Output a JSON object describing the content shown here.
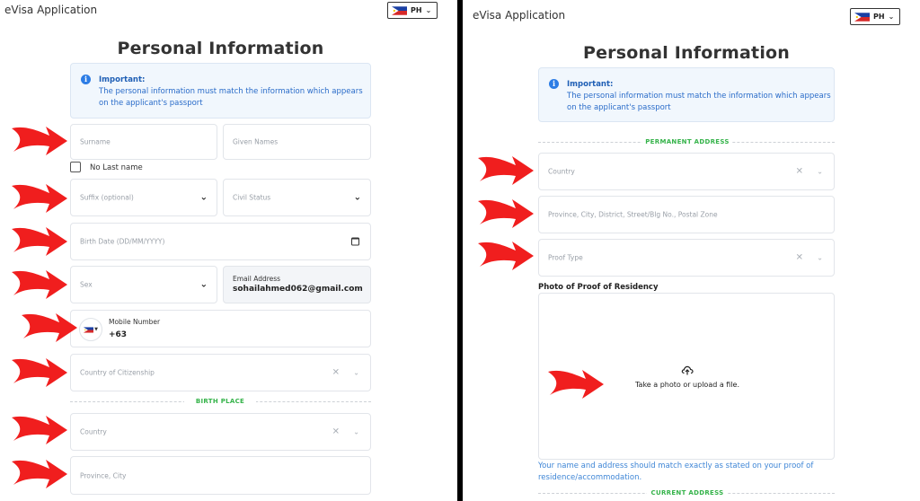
{
  "colors": {
    "accent_blue": "#2d7de5",
    "section_green": "#35b34a",
    "arrow_red": "#f01e1e"
  },
  "left": {
    "app_title": "eVisa Application",
    "language": "PH",
    "page_title": "Personal Information",
    "notice_title": "Important:",
    "notice_line1": "The personal information must match the information which appears",
    "notice_line2": "on the applicant's passport",
    "surname_placeholder": "Surname",
    "given_names_placeholder": "Given Names",
    "no_last_name_label": "No Last name",
    "suffix_placeholder": "Suffix (optional)",
    "civil_status_placeholder": "Civil Status",
    "birth_date_placeholder": "Birth Date (DD/MM/YYYY)",
    "sex_placeholder": "Sex",
    "email_label": "Email Address",
    "email_value": "sohailahmed062@gmail.com",
    "mobile_label": "Mobile Number",
    "mobile_value": "+63",
    "citizenship_placeholder": "Country of Citizenship",
    "birth_place_section": "BIRTH PLACE",
    "country_placeholder": "Country",
    "province_city_placeholder": "Province, City"
  },
  "right": {
    "app_title": "eVisa Application",
    "language": "PH",
    "page_title": "Personal Information",
    "notice_title": "Important:",
    "notice_line1": "The personal information must match the information which appears",
    "notice_line2": "on the applicant's passport",
    "permanent_address_section": "PERMANENT ADDRESS",
    "country_placeholder": "Country",
    "address_placeholder": "Province, City, District, Street/Blg No., Postal Zone",
    "proof_type_placeholder": "Proof Type",
    "photo_proof_label": "Photo of Proof of Residency",
    "upload_text": "Take a photo or upload a file.",
    "helper_line1": "Your name and address should match exactly as stated on your proof of",
    "helper_line2": "residence/accommodation.",
    "current_address_section": "CURRENT ADDRESS"
  }
}
